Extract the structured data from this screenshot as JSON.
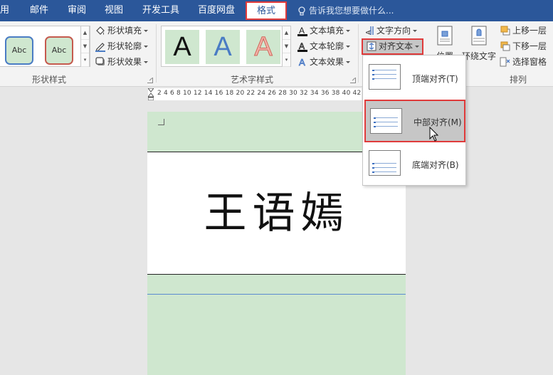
{
  "tabs": [
    {
      "label": "用"
    },
    {
      "label": "邮件"
    },
    {
      "label": "审阅"
    },
    {
      "label": "视图"
    },
    {
      "label": "开发工具"
    },
    {
      "label": "百度网盘"
    },
    {
      "label": "格式"
    }
  ],
  "tell_me": {
    "placeholder": "告诉我您想要做什么..."
  },
  "shape_styles": {
    "swatch_1": "Abc",
    "swatch_2": "Abc",
    "fill": "形状填充",
    "outline": "形状轮廓",
    "effects": "形状效果",
    "group_label": "形状样式"
  },
  "art_styles": {
    "tile_1": "A",
    "tile_2": "A",
    "tile_3": "A",
    "text_fill": "文本填充",
    "text_outline": "文本轮廓",
    "text_effects": "文本效果",
    "group_label": "艺术字样式"
  },
  "text_group": {
    "direction": "文字方向",
    "align_text": "对齐文本"
  },
  "arrange": {
    "position": "位置",
    "wrap_text": "环绕文字",
    "bring_forward": "上移一层",
    "send_backward": "下移一层",
    "selection_pane": "选择窗格",
    "group_label": "排列"
  },
  "ruler": {
    "ticks": "2  4  6  8 10 12 14 16 18 20 22 24 26 28 30 32 34 36 38 40 42 44 46"
  },
  "document": {
    "name": "王语嫣"
  },
  "align_menu": {
    "items": [
      {
        "label": "顶端对齐(T)"
      },
      {
        "label": "中部对齐(M)"
      },
      {
        "label": "底端对齐(B)"
      }
    ]
  },
  "colors": {
    "title_bar": "#2b579a",
    "highlight_border": "#e03a3a",
    "page_bg": "#cfe7cf",
    "selected_item": "#c6c6c6"
  }
}
